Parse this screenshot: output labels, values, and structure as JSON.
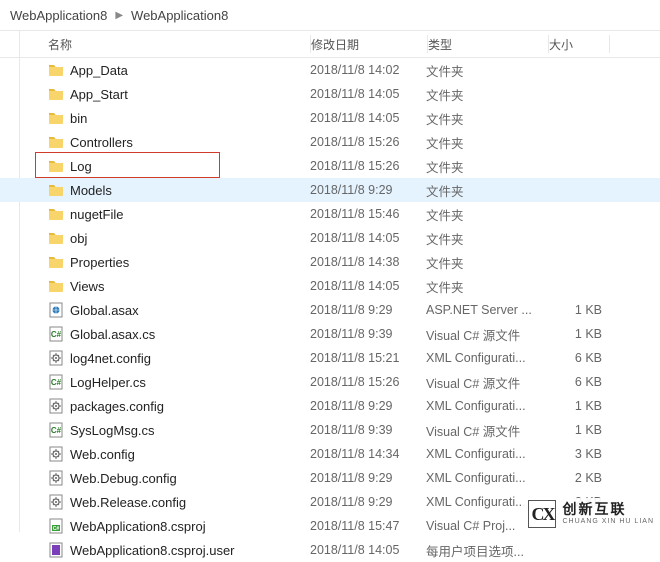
{
  "breadcrumb": {
    "a": "WebApplication8",
    "b": "WebApplication8"
  },
  "headers": {
    "name": "名称",
    "date": "修改日期",
    "type": "类型",
    "size": "大小"
  },
  "rows": [
    {
      "icon": "folder",
      "name": "App_Data",
      "date": "2018/11/8 14:02",
      "type": "文件夹",
      "size": ""
    },
    {
      "icon": "folder",
      "name": "App_Start",
      "date": "2018/11/8 14:05",
      "type": "文件夹",
      "size": ""
    },
    {
      "icon": "folder",
      "name": "bin",
      "date": "2018/11/8 14:05",
      "type": "文件夹",
      "size": ""
    },
    {
      "icon": "folder",
      "name": "Controllers",
      "date": "2018/11/8 15:26",
      "type": "文件夹",
      "size": ""
    },
    {
      "icon": "folder",
      "name": "Log",
      "date": "2018/11/8 15:26",
      "type": "文件夹",
      "size": ""
    },
    {
      "icon": "folder",
      "name": "Models",
      "date": "2018/11/8 9:29",
      "type": "文件夹",
      "size": "",
      "hover": true
    },
    {
      "icon": "folder",
      "name": "nugetFile",
      "date": "2018/11/8 15:46",
      "type": "文件夹",
      "size": ""
    },
    {
      "icon": "folder",
      "name": "obj",
      "date": "2018/11/8 14:05",
      "type": "文件夹",
      "size": ""
    },
    {
      "icon": "folder",
      "name": "Properties",
      "date": "2018/11/8 14:38",
      "type": "文件夹",
      "size": ""
    },
    {
      "icon": "folder",
      "name": "Views",
      "date": "2018/11/8 14:05",
      "type": "文件夹",
      "size": ""
    },
    {
      "icon": "asax",
      "name": "Global.asax",
      "date": "2018/11/8 9:29",
      "type": "ASP.NET Server ...",
      "size": "1 KB"
    },
    {
      "icon": "cs",
      "name": "Global.asax.cs",
      "date": "2018/11/8 9:39",
      "type": "Visual C# 源文件",
      "size": "1 KB"
    },
    {
      "icon": "config",
      "name": "log4net.config",
      "date": "2018/11/8 15:21",
      "type": "XML Configurati...",
      "size": "6 KB"
    },
    {
      "icon": "cs",
      "name": "LogHelper.cs",
      "date": "2018/11/8 15:26",
      "type": "Visual C# 源文件",
      "size": "6 KB"
    },
    {
      "icon": "config",
      "name": "packages.config",
      "date": "2018/11/8 9:29",
      "type": "XML Configurati...",
      "size": "1 KB"
    },
    {
      "icon": "cs",
      "name": "SysLogMsg.cs",
      "date": "2018/11/8 9:39",
      "type": "Visual C# 源文件",
      "size": "1 KB"
    },
    {
      "icon": "config",
      "name": "Web.config",
      "date": "2018/11/8 14:34",
      "type": "XML Configurati...",
      "size": "3 KB"
    },
    {
      "icon": "config",
      "name": "Web.Debug.config",
      "date": "2018/11/8 9:29",
      "type": "XML Configurati...",
      "size": "2 KB"
    },
    {
      "icon": "config",
      "name": "Web.Release.config",
      "date": "2018/11/8 9:29",
      "type": "XML Configurati...",
      "size": "2 KB"
    },
    {
      "icon": "csproj",
      "name": "WebApplication8.csproj",
      "date": "2018/11/8 15:47",
      "type": "Visual C# Proj...",
      "size": ""
    },
    {
      "icon": "user",
      "name": "WebApplication8.csproj.user",
      "date": "2018/11/8 14:05",
      "type": "每用户项目选项...",
      "size": ""
    }
  ],
  "watermark": {
    "logo": "CX",
    "big": "创新互联",
    "small": "CHUANG XIN HU LIAN"
  }
}
